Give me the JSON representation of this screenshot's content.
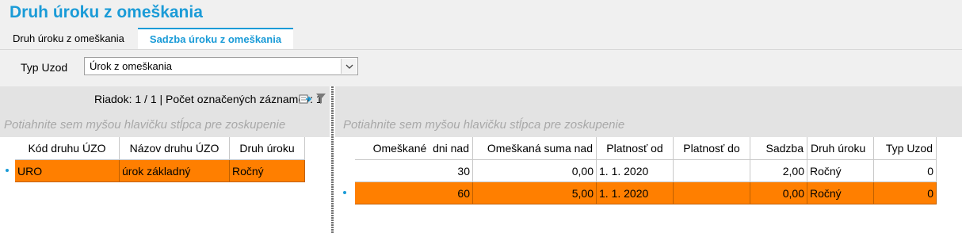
{
  "title": "Druh úroku z omeškania",
  "tabs": [
    {
      "label": "Druh úroku z omeškania"
    },
    {
      "label": "Sadzba úroku z omeškania"
    }
  ],
  "filter": {
    "label": "Typ Uzod",
    "value": "Úrok z omeškania"
  },
  "left": {
    "info": "Riadok: 1 / 1 | Počet označených záznamov: 1",
    "group_hint": "Potiahnite sem myšou hlavičku stĺpca pre zoskupenie",
    "columns": [
      "Kód druhu ÚZO",
      "Názov druhu ÚZO",
      "Druh úroku"
    ],
    "rows": [
      [
        "URO",
        "úrok základný",
        "Ročný"
      ]
    ]
  },
  "right": {
    "group_hint": "Potiahnite sem myšou hlavičku stĺpca pre zoskupenie",
    "columns": [
      "Omeškané  dni nad",
      "Omeškaná suma nad",
      "Platnosť od",
      "Platnosť do",
      "Sadzba",
      "Druh úroku",
      "Typ Uzod"
    ],
    "rows": [
      [
        "30",
        "0,00",
        "1. 1. 2020",
        "",
        "2,00",
        "Ročný",
        "0"
      ],
      [
        "60",
        "5,00",
        "1. 1. 2020",
        "",
        "0,00",
        "Ročný",
        "0"
      ]
    ]
  },
  "icons": {
    "export": "export-icon",
    "filter": "filter-icon",
    "dropdown": "chevron-down-icon"
  }
}
